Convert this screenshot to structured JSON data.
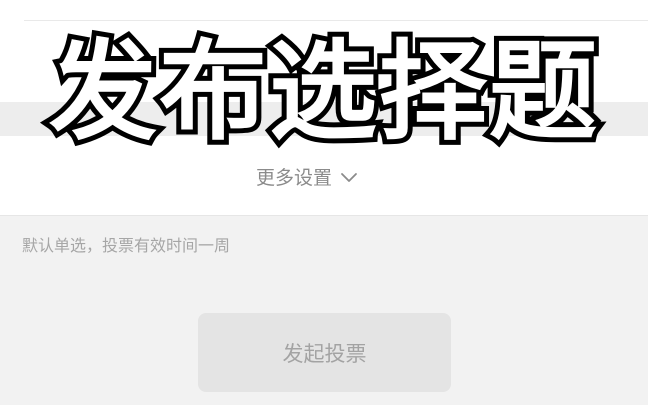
{
  "overlay": {
    "title": "发布选择题"
  },
  "settings": {
    "more_label": "更多设置",
    "chevron_icon": "chevron-down-icon"
  },
  "hint": {
    "text": "默认单选，投票有效时间一周"
  },
  "actions": {
    "publish_label": "发起投票"
  },
  "colors": {
    "accent_pink": "#f06a86",
    "button_bg": "#e4e4e4",
    "button_text": "#a3a3a3"
  }
}
